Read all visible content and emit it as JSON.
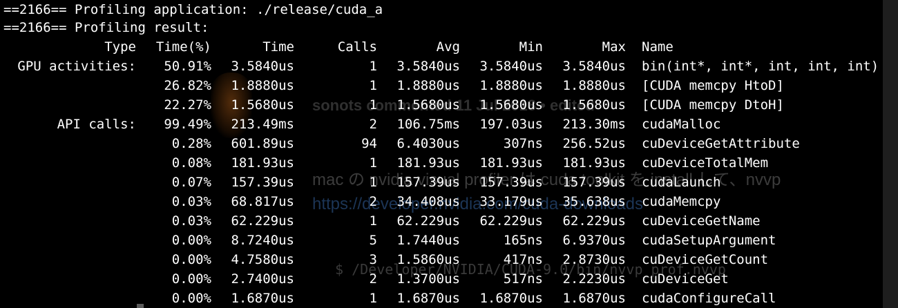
{
  "background_page": {
    "meta_text": "sonots commented 11 Jul 2018 • edited",
    "body_text": "mac の nvidia visual profiler は cuda toolkit を install して、nvvp",
    "link_text": "https://developer.nvidia.com/cuda-downloads",
    "code_text": "$ /Developer/NVIDIA/CUDA-9.0/bin/nvvp_prof.nvvp"
  },
  "terminal": {
    "lines": [
      "==2166== Profiling application: ./release/cuda_a",
      "==2166== Profiling result:"
    ],
    "headers": {
      "type": "Type",
      "time_pct": "Time(%)",
      "time": "Time",
      "calls": "Calls",
      "avg": "Avg",
      "min": "Min",
      "max": "Max",
      "name": "Name"
    },
    "rows": [
      {
        "type": "GPU activities:",
        "time_pct": "50.91%",
        "time": "3.5840us",
        "calls": "1",
        "avg": "3.5840us",
        "min": "3.5840us",
        "max": "3.5840us",
        "name": "bin(int*, int*, int, int, int)"
      },
      {
        "type": "",
        "time_pct": "26.82%",
        "time": "1.8880us",
        "calls": "1",
        "avg": "1.8880us",
        "min": "1.8880us",
        "max": "1.8880us",
        "name": "[CUDA memcpy HtoD]"
      },
      {
        "type": "",
        "time_pct": "22.27%",
        "time": "1.5680us",
        "calls": "1",
        "avg": "1.5680us",
        "min": "1.5680us",
        "max": "1.5680us",
        "name": "[CUDA memcpy DtoH]"
      },
      {
        "type": "API calls:",
        "time_pct": "99.49%",
        "time": "213.49ms",
        "calls": "2",
        "avg": "106.75ms",
        "min": "197.03us",
        "max": "213.30ms",
        "name": "cudaMalloc"
      },
      {
        "type": "",
        "time_pct": "0.28%",
        "time": "601.89us",
        "calls": "94",
        "avg": "6.4030us",
        "min": "307ns",
        "max": "256.52us",
        "name": "cuDeviceGetAttribute"
      },
      {
        "type": "",
        "time_pct": "0.08%",
        "time": "181.93us",
        "calls": "1",
        "avg": "181.93us",
        "min": "181.93us",
        "max": "181.93us",
        "name": "cuDeviceTotalMem"
      },
      {
        "type": "",
        "time_pct": "0.07%",
        "time": "157.39us",
        "calls": "1",
        "avg": "157.39us",
        "min": "157.39us",
        "max": "157.39us",
        "name": "cudaLaunch"
      },
      {
        "type": "",
        "time_pct": "0.03%",
        "time": "68.817us",
        "calls": "2",
        "avg": "34.408us",
        "min": "33.179us",
        "max": "35.638us",
        "name": "cudaMemcpy"
      },
      {
        "type": "",
        "time_pct": "0.03%",
        "time": "62.229us",
        "calls": "1",
        "avg": "62.229us",
        "min": "62.229us",
        "max": "62.229us",
        "name": "cuDeviceGetName"
      },
      {
        "type": "",
        "time_pct": "0.00%",
        "time": "8.7240us",
        "calls": "5",
        "avg": "1.7440us",
        "min": "165ns",
        "max": "6.9370us",
        "name": "cudaSetupArgument"
      },
      {
        "type": "",
        "time_pct": "0.00%",
        "time": "4.7580us",
        "calls": "3",
        "avg": "1.5860us",
        "min": "417ns",
        "max": "2.8730us",
        "name": "cuDeviceGetCount"
      },
      {
        "type": "",
        "time_pct": "0.00%",
        "time": "2.7400us",
        "calls": "2",
        "avg": "1.3700us",
        "min": "517ns",
        "max": "2.2230us",
        "name": "cuDeviceGet"
      },
      {
        "type": "",
        "time_pct": "0.00%",
        "time": "1.6870us",
        "calls": "1",
        "avg": "1.6870us",
        "min": "1.6870us",
        "max": "1.6870us",
        "name": "cudaConfigureCall"
      }
    ]
  },
  "colors": {
    "background": "#000000",
    "text": "#ffffff"
  }
}
